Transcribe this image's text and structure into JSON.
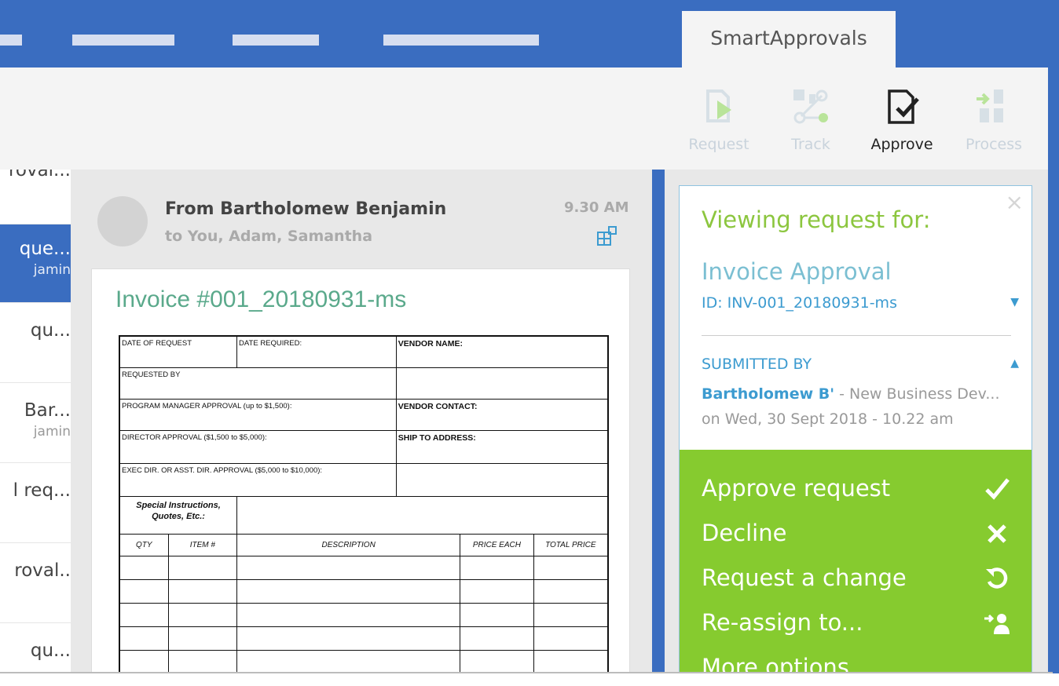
{
  "app": {
    "tab_label": "SmartApprovals"
  },
  "ribbon": {
    "buttons": [
      {
        "label": "Request",
        "icon": "send-document-icon",
        "state": "disabled"
      },
      {
        "label": "Track",
        "icon": "workflow-track-icon",
        "state": "disabled"
      },
      {
        "label": "Approve",
        "icon": "approve-document-icon",
        "state": "active"
      },
      {
        "label": "Process",
        "icon": "process-icon",
        "state": "disabled"
      }
    ]
  },
  "mail_list": {
    "items": [
      {
        "title": "roval...",
        "subtitle": ""
      },
      {
        "title": "que...",
        "subtitle": "jamin",
        "selected": true
      },
      {
        "title": "qu...",
        "subtitle": ""
      },
      {
        "title": "Bar...",
        "subtitle": "jamin"
      },
      {
        "title": "l req...",
        "subtitle": ""
      },
      {
        "title": "roval..",
        "subtitle": ""
      },
      {
        "title": "qu...",
        "subtitle": ""
      }
    ]
  },
  "message": {
    "from": "From Bartholomew Benjamin",
    "to": "to  You, Adam, Samantha",
    "time": "9.30 AM",
    "doc_title": "Invoice #001_20180931-ms",
    "form": {
      "date_of_request": "DATE OF REQUEST",
      "date_required": "DATE REQUIRED:",
      "vendor_name": "VENDOR NAME:",
      "requested_by": "REQUESTED BY",
      "program_manager": "PROGRAM MANAGER APPROVAL (up to $1,500):",
      "vendor_contact": "VENDOR CONTACT:",
      "director": "DIRECTOR APPROVAL ($1,500 to $5,000):",
      "ship_to": "SHIP TO ADDRESS:",
      "exec_dir": "EXEC DIR. OR ASST. DIR. APPROVAL ($5,000 to $10,000):",
      "special_instructions": "Special Instructions, Quotes, Etc.:",
      "columns": [
        "QTY",
        "ITEM #",
        "DESCRIPTION",
        "PRICE EACH",
        "TOTAL PRICE"
      ]
    }
  },
  "panel": {
    "viewing_label": "Viewing request for:",
    "request_type": "Invoice Approval",
    "request_id": "ID:  INV-001_20180931-ms",
    "submitted_label": "SUBMITTED BY",
    "submitter_name": "Bartholomew B'",
    "submitter_dept": " - New Business Dev...",
    "submitted_on": "on Wed, 30 Sept 2018 - 10.22 am",
    "actions": [
      {
        "label": "Approve request",
        "icon": "check-icon"
      },
      {
        "label": "Decline",
        "icon": "close-icon"
      },
      {
        "label": "Request a change",
        "icon": "undo-icon"
      },
      {
        "label": "Re-assign to...",
        "icon": "reassign-user-icon"
      },
      {
        "label": "More options",
        "icon": ""
      }
    ]
  },
  "colors": {
    "brand_blue": "#3a6dc0",
    "action_green": "#86cb2f",
    "heading_green": "#8cc63f",
    "accent_blue": "#3c9bd0",
    "doc_title_teal": "#5aa98b"
  }
}
